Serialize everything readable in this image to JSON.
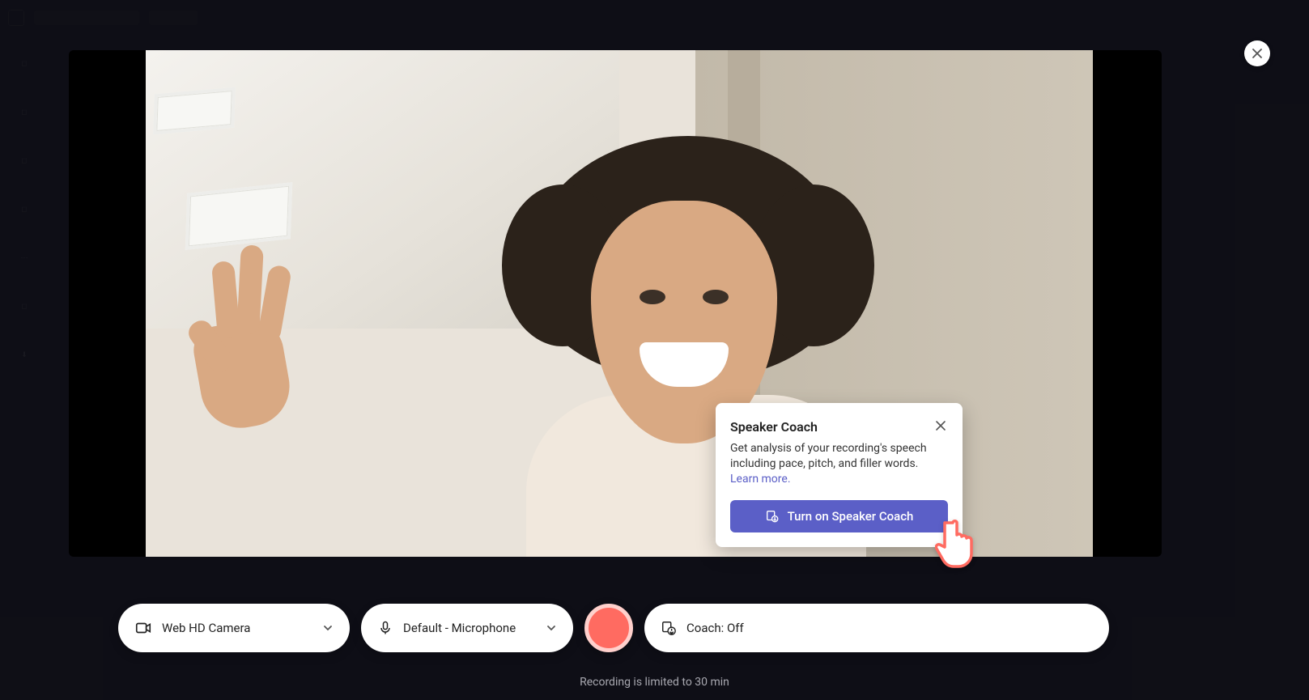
{
  "popup": {
    "title": "Speaker Coach",
    "body": "Get analysis of your recording's speech including pace, pitch, and filler words.",
    "link_label": "Learn more.",
    "button_label": "Turn on Speaker Coach"
  },
  "toolbar": {
    "camera": {
      "label": "Web HD Camera"
    },
    "mic": {
      "label": "Default - Microphone"
    },
    "coach": {
      "label": "Coach: Off"
    }
  },
  "footer": {
    "text": "Recording is limited to 30 min"
  }
}
